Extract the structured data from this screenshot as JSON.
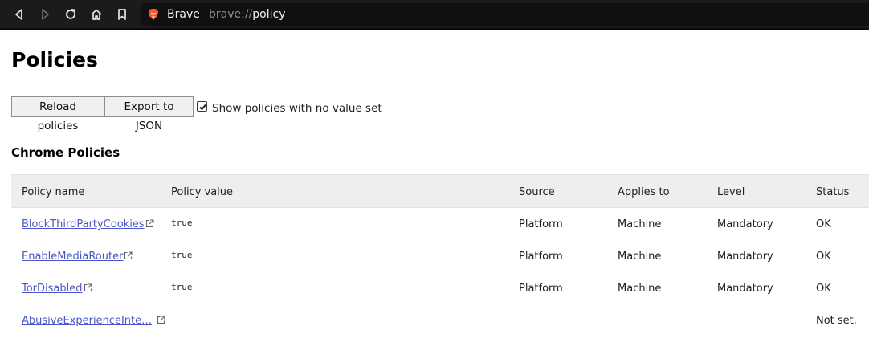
{
  "browser": {
    "site_name": "Brave",
    "url_scheme": "brave://",
    "url_host": "policy",
    "nav_icons": [
      "back-icon",
      "forward-icon",
      "reload-icon",
      "home-icon",
      "bookmark-icon"
    ]
  },
  "page": {
    "title": "Policies",
    "reload_label": "Reload policies",
    "export_label": "Export to JSON",
    "show_unset_label": "Show policies with no value set",
    "show_unset_checked": true,
    "section_title": "Chrome Policies"
  },
  "table": {
    "headers": {
      "name": "Policy name",
      "value": "Policy value",
      "source": "Source",
      "applies": "Applies to",
      "level": "Level",
      "status": "Status"
    },
    "rows": [
      {
        "name": "BlockThirdPartyCookies",
        "value": "true",
        "source": "Platform",
        "applies": "Machine",
        "level": "Mandatory",
        "status": "OK"
      },
      {
        "name": "EnableMediaRouter",
        "value": "true",
        "source": "Platform",
        "applies": "Machine",
        "level": "Mandatory",
        "status": "OK"
      },
      {
        "name": "TorDisabled",
        "value": "true",
        "source": "Platform",
        "applies": "Machine",
        "level": "Mandatory",
        "status": "OK"
      },
      {
        "name": "AbusiveExperienceInte…",
        "value": "",
        "source": "",
        "applies": "",
        "level": "",
        "status": "Not set."
      }
    ]
  },
  "colors": {
    "toolbar_bg": "#1b1b1b",
    "link": "#4a55c8",
    "brave_orange": "#fb542b"
  }
}
